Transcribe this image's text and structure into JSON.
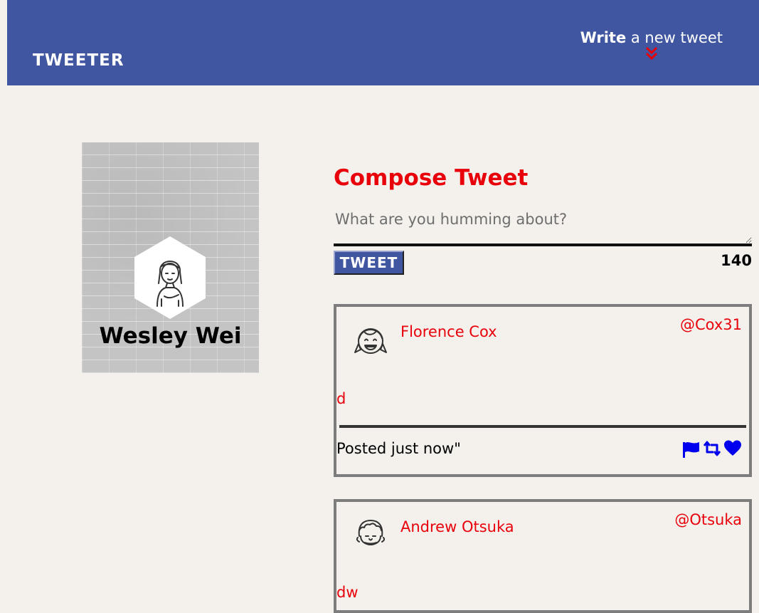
{
  "nav": {
    "brand": "TWEETER",
    "write_strong": "Write",
    "write_rest": " a new tweet",
    "chevron_icon": "double-chevron-down-icon",
    "bg_color": "#4056a1",
    "accent_color": "#e8000b"
  },
  "profile": {
    "name": "Wesley Wei",
    "avatar_icon": "woman-avatar-icon"
  },
  "compose": {
    "heading": "Compose Tweet",
    "placeholder": "What are you humming about?",
    "button_label": "TWEET",
    "counter": "140"
  },
  "tweets": [
    {
      "avatar_icon": "girl-avatar-icon",
      "name": "Florence Cox",
      "handle": "@Cox31",
      "body": "d",
      "time": "Posted just now\"",
      "actions": [
        "flag-icon",
        "retweet-icon",
        "heart-icon"
      ]
    },
    {
      "avatar_icon": "curly-man-avatar-icon",
      "name": "Andrew Otsuka",
      "handle": "@Otsuka",
      "body": "dw"
    }
  ]
}
